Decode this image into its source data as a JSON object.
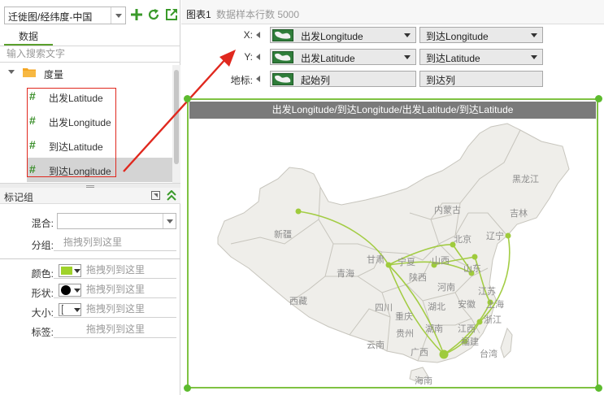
{
  "left_panel": {
    "chart_select_value": "迁徙图/经纬度-中国",
    "tab_label": "数据",
    "search_placeholder": "输入搜索文字",
    "group_label": "度量",
    "fields": [
      "出发Latitude",
      "出发Longitude",
      "到达Latitude",
      "到达Longitude"
    ],
    "selected_field_index": 3
  },
  "mark_panel": {
    "title": "标记组",
    "mix_label": "混合:",
    "group_label": "分组:",
    "group_placeholder": "拖拽列到这里",
    "color_label": "颜色:",
    "color_placeholder": "拖拽列到这里",
    "shape_label": "形状:",
    "shape_placeholder": "拖拽列到这里",
    "size_label": "大小:",
    "size_placeholder": "拖拽列到这里",
    "tag_label": "标签:",
    "tag_placeholder": "拖拽列到这里",
    "color_value": "#9fd22a"
  },
  "header": {
    "title": "图表1",
    "sample_info": "数据样本行数 5000"
  },
  "axes": {
    "x_label": "X:",
    "x_from": "出发Longitude",
    "x_to": "到达Longitude",
    "y_label": "Y:",
    "y_from": "出发Latitude",
    "y_to": "到达Latitude",
    "loc_label": "地标:",
    "loc_from": "起始列",
    "loc_to": "到达列"
  },
  "chart": {
    "title": "出发Longitude/到达Longitude/出发Latitude/到达Latitude",
    "provinces": [
      "黑龙江",
      "吉林",
      "辽宁",
      "内蒙古",
      "北京",
      "新疆",
      "甘肃",
      "宁夏",
      "山西",
      "山东",
      "青海",
      "陕西",
      "河南",
      "江苏",
      "西藏",
      "四川",
      "湖北",
      "安徽",
      "上海",
      "重庆",
      "浙江",
      "湖南",
      "江西",
      "贵州",
      "云南",
      "广西",
      "福建",
      "台湾",
      "海南"
    ]
  },
  "colors": {
    "accent_green": "#7fc242",
    "flow_line": "#9fcb3c",
    "annotation_red": "#e0281e"
  }
}
